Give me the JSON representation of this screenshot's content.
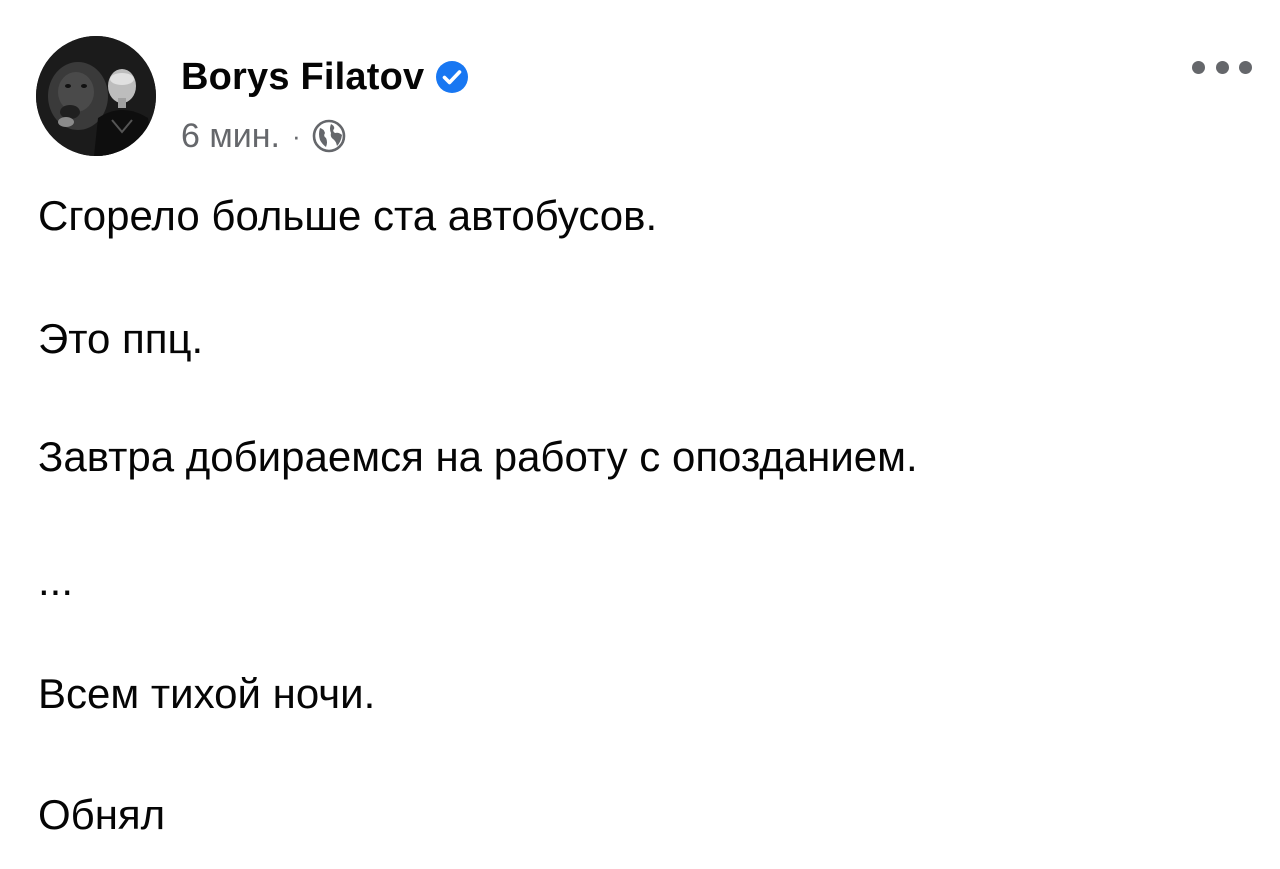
{
  "post": {
    "author": {
      "name": "Borys Filatov",
      "verified": true,
      "verified_icon": "verified-badge-icon",
      "verified_color": "#1877f2"
    },
    "meta": {
      "time": "6 мин.",
      "separator": "·",
      "audience_icon": "globe-icon"
    },
    "menu_icon": "more-options-icon",
    "text_lines": [
      "Сгорело больше ста автобусов.",
      "Это ппц.",
      "Завтра добираемся на работу с опозданием.",
      "...",
      "Всем тихой ночи.",
      "Обнял"
    ]
  },
  "colors": {
    "text_primary": "#050505",
    "text_secondary": "#65676b",
    "background": "#ffffff"
  }
}
